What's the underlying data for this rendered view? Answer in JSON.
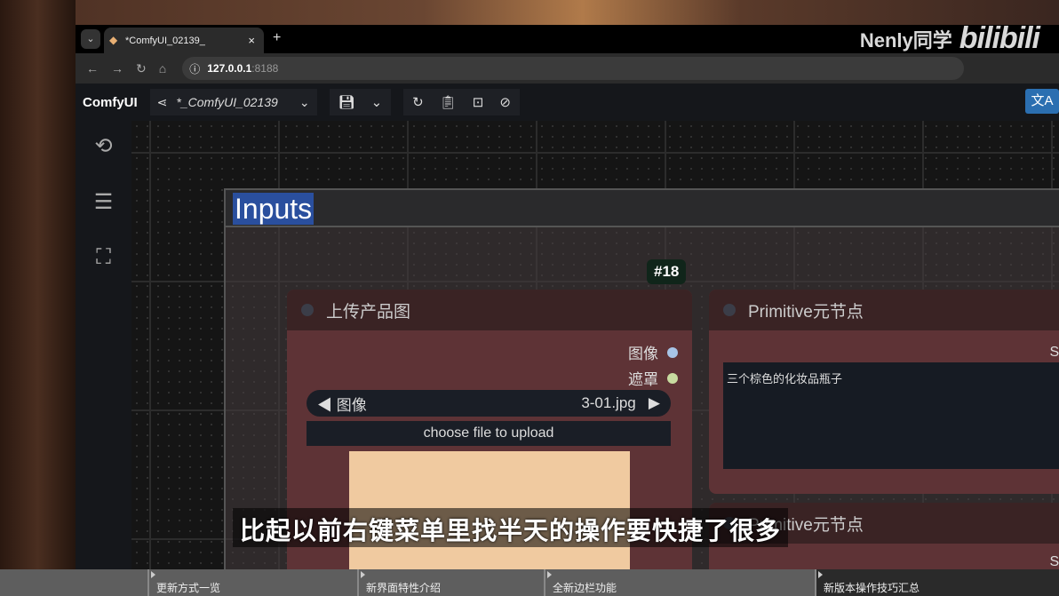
{
  "browser": {
    "tab_title": "*ComfyUI_02139_",
    "url_host": "127.0.0.1",
    "url_port": ":8188",
    "watermark_name": "Nenly同学",
    "watermark_logo": "bilibili"
  },
  "menubar": {
    "app_name": "ComfyUI",
    "workflow_name": "*_ComfyUI_02139",
    "translate_icon": "文A"
  },
  "canvas": {
    "group_title": "Inputs",
    "node_badge": "#18",
    "load_image_node": {
      "title": "上传产品图",
      "outputs": [
        {
          "label": "图像",
          "color": "#a7c4e6"
        },
        {
          "label": "遮罩",
          "color": "#c8dba0"
        }
      ],
      "combo_label": "图像",
      "combo_value": "3-01.jpg",
      "upload_label": "choose file to upload"
    },
    "primitive_node": {
      "title": "Primitive元节点",
      "output": "STRI",
      "text": "三个棕色的化妆品瓶子"
    },
    "primitive_node2": {
      "title": "Primitive元节点",
      "output": "STRI"
    }
  },
  "subtitle": "比起以前右键菜单里找半天的操作要快捷了很多",
  "chapters": [
    "更新方式一览",
    "新界面特性介绍",
    "全新边栏功能",
    "新版本操作技巧汇总"
  ]
}
